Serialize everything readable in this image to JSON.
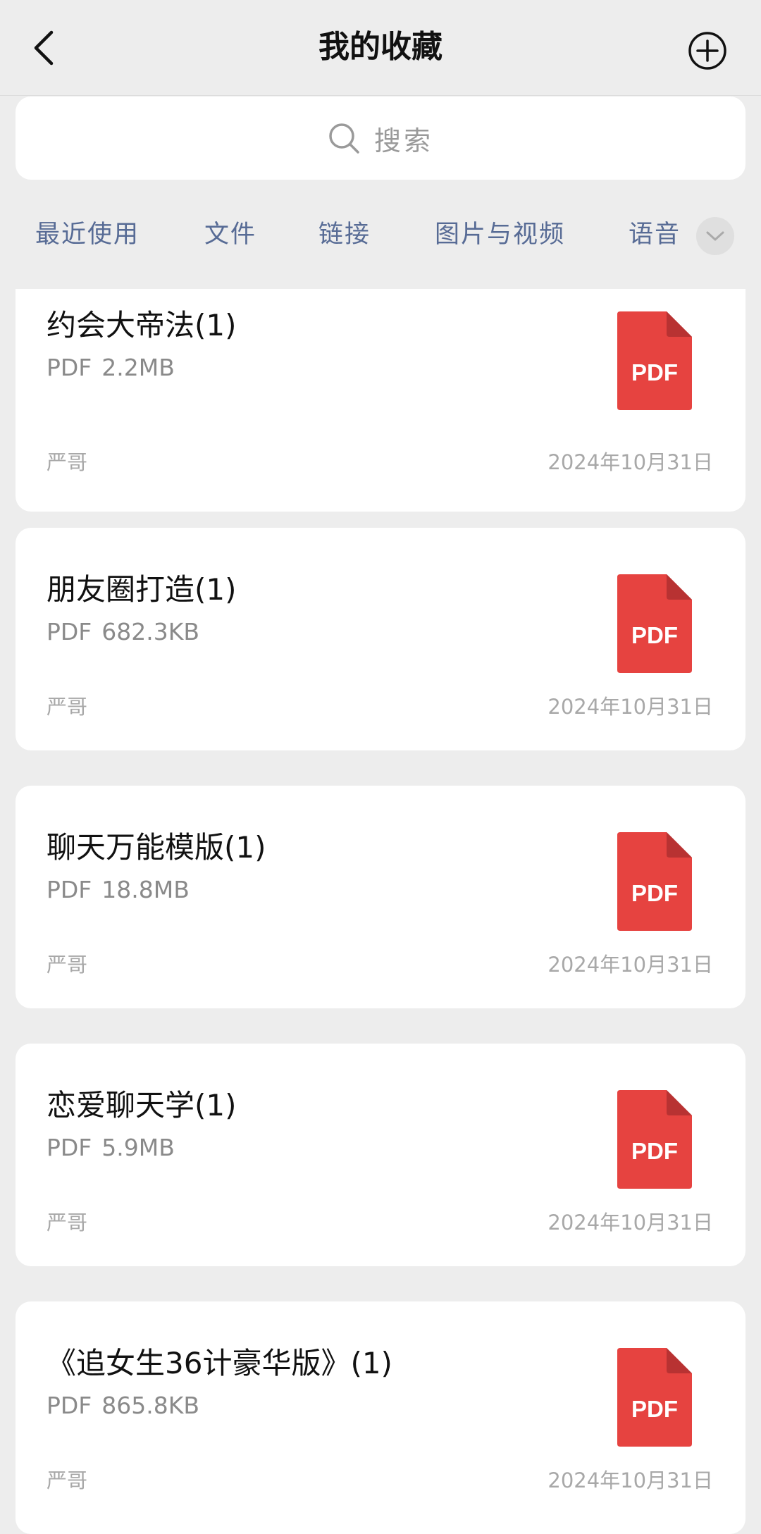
{
  "header": {
    "title": "我的收藏"
  },
  "search": {
    "placeholder": "搜索"
  },
  "tabs": [
    {
      "label": "最近使用"
    },
    {
      "label": "文件"
    },
    {
      "label": "链接"
    },
    {
      "label": "图片与视频"
    },
    {
      "label": "语音"
    }
  ],
  "file_icon_label": "PDF",
  "items": [
    {
      "name": "约会大帝法(1)",
      "type": "PDF",
      "size": "2.2MB",
      "source": "严哥",
      "date": "2024年10月31日"
    },
    {
      "name": "朋友圈打造(1)",
      "type": "PDF",
      "size": "682.3KB",
      "source": "严哥",
      "date": "2024年10月31日"
    },
    {
      "name": "聊天万能模版(1)",
      "type": "PDF",
      "size": "18.8MB",
      "source": "严哥",
      "date": "2024年10月31日"
    },
    {
      "name": "恋爱聊天学(1)",
      "type": "PDF",
      "size": "5.9MB",
      "source": "严哥",
      "date": "2024年10月31日"
    },
    {
      "name": "《追女生36计豪华版》(1)",
      "type": "PDF",
      "size": "865.8KB",
      "source": "严哥",
      "date": "2024年10月31日"
    }
  ],
  "colors": {
    "link_blue": "#576b95",
    "pdf_red": "#e64340",
    "pdf_fold": "#b83232"
  }
}
